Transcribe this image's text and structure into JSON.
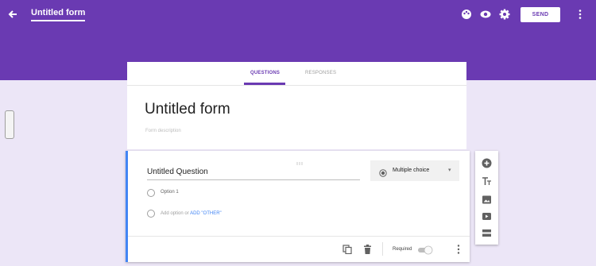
{
  "header": {
    "form_title": "Untitled form",
    "send_label": "SEND",
    "icons": [
      "back-arrow-icon",
      "palette-icon",
      "preview-eye-icon",
      "settings-gear-icon",
      "more-vert-icon"
    ]
  },
  "tabs": [
    {
      "label": "QUESTIONS",
      "active": true
    },
    {
      "label": "RESPONSES",
      "active": false
    }
  ],
  "form": {
    "title": "Untitled form",
    "description_placeholder": "Form description"
  },
  "question": {
    "title": "Untitled Question",
    "type": "Multiple choice",
    "options": [
      "Option 1"
    ],
    "add_option": "Add option",
    "or": "or",
    "add_other": "ADD \"OTHER\"",
    "required_label": "Required",
    "required": false
  },
  "toolbar": {
    "tools": [
      "add-question-icon",
      "add-title-icon",
      "add-image-icon",
      "add-video-icon",
      "add-section-icon"
    ]
  },
  "colors": {
    "theme": "#6a3ab2",
    "background": "#ece6f7",
    "accent": "#4285f4"
  }
}
